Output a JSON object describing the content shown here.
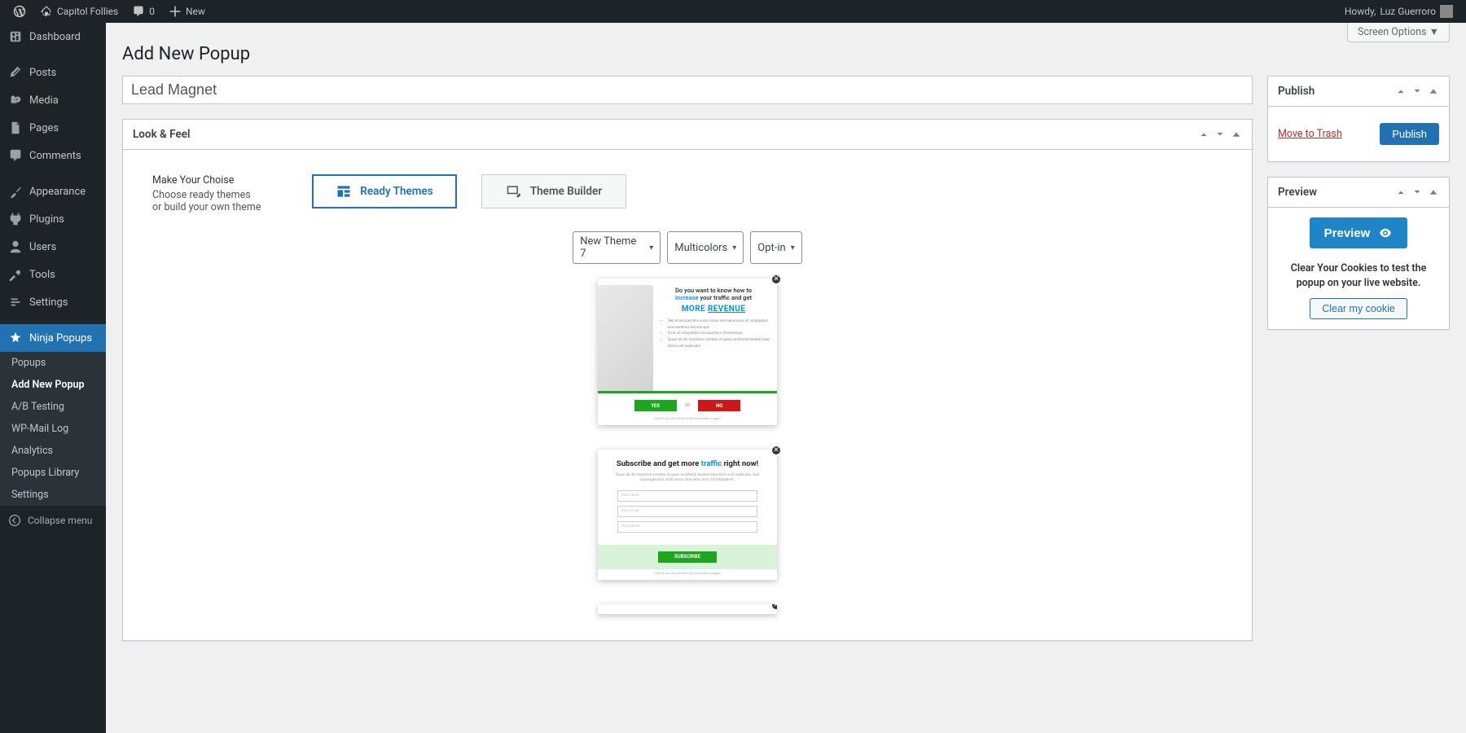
{
  "topbar": {
    "site_name": "Capitol Follies",
    "comments_count": "0",
    "new_label": "New",
    "howdy_prefix": "Howdy,",
    "user_name": "Luz Guerroro"
  },
  "sidebar": {
    "dashboard": "Dashboard",
    "posts": "Posts",
    "media": "Media",
    "pages": "Pages",
    "comments": "Comments",
    "appearance": "Appearance",
    "plugins": "Plugins",
    "users": "Users",
    "tools": "Tools",
    "settings": "Settings",
    "ninja_popups": "Ninja Popups",
    "submenu": {
      "popups": "Popups",
      "add_new": "Add New Popup",
      "ab_testing": "A/B Testing",
      "wp_mail_log": "WP-Mail Log",
      "analytics": "Analytics",
      "popups_library": "Popups Library",
      "settings": "Settings"
    },
    "collapse": "Collapse menu"
  },
  "screen_options": "Screen Options",
  "page_title": "Add New Popup",
  "title_input_value": "Lead Magnet",
  "look_feel": {
    "header": "Look & Feel",
    "choice_title": "Make Your Choise",
    "choice_line1": "Choose ready themes",
    "choice_line2": "or build your own theme",
    "tab_ready": "Ready Themes",
    "tab_builder": "Theme Builder",
    "select_theme": "New Theme 7",
    "select_color": "Multicolors",
    "select_type": "Opt-in",
    "preview1": {
      "line1a": "Do you want to know how to",
      "line1b_highlight": "increase",
      "line1b_rest": "your traffic and get",
      "line2a": "MORE",
      "line2b": "REVENUE",
      "bullets": [
        "Sed id perspeciatis unde omnis iste natus error sit voluptatem accusantium doloremque",
        "Error sit voluptatem accusantium doloremque",
        "Quasi ab illo inventore veritatis et quasi architecto beatae vitae dicta sunt explicabo"
      ],
      "yes": "YES",
      "or": "OR",
      "no": "NO",
      "footer": "Click if you do not need this information again"
    },
    "preview2": {
      "head_a": "Subscribe and get more",
      "head_b": "traffic",
      "head_c": "right now!",
      "sub": "Quasi ab illo inventore veritatis et quasi architecto beatae vitae dicta sunt explicabo. Sed id perspeciatis unde omnis iste natus error sit voluptatem.",
      "ph_name": "Your name",
      "ph_email": "Your e-mail",
      "ph_phone": "Your phone",
      "subscribe": "SUBSCRIBE",
      "footer": "Click if you do not need this information again"
    }
  },
  "publish_box": {
    "header": "Publish",
    "trash": "Move to Trash",
    "publish_btn": "Publish"
  },
  "preview_box": {
    "header": "Preview",
    "preview_btn": "Preview",
    "note": "Clear Your Cookies to test the popup on your live website.",
    "clear_btn": "Clear my cookie"
  }
}
